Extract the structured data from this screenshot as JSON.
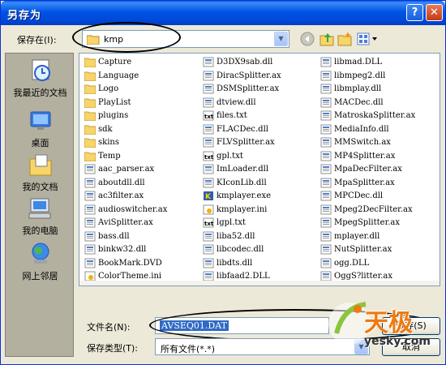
{
  "window": {
    "title": "另存为"
  },
  "titlebar": {
    "help": "?",
    "close": "✕"
  },
  "save_in": {
    "label": "保存在(I):",
    "value": "kmp"
  },
  "places": [
    {
      "label": "我最近的文档",
      "icon": "recent-docs-icon"
    },
    {
      "label": "桌面",
      "icon": "desktop-icon"
    },
    {
      "label": "我的文档",
      "icon": "my-documents-icon"
    },
    {
      "label": "我的电脑",
      "icon": "my-computer-icon"
    },
    {
      "label": "网上邻居",
      "icon": "network-icon"
    }
  ],
  "files": {
    "col1": [
      {
        "name": "Capture",
        "type": "folder"
      },
      {
        "name": "Language",
        "type": "folder"
      },
      {
        "name": "Logo",
        "type": "folder"
      },
      {
        "name": "PlayList",
        "type": "folder"
      },
      {
        "name": "plugins",
        "type": "folder"
      },
      {
        "name": "sdk",
        "type": "folder"
      },
      {
        "name": "skins",
        "type": "folder"
      },
      {
        "name": "Temp",
        "type": "folder"
      },
      {
        "name": "aac_parser.ax",
        "type": "ax"
      },
      {
        "name": "aboutdll.dll",
        "type": "dll"
      },
      {
        "name": "ac3filter.ax",
        "type": "ax"
      },
      {
        "name": "audioswitcher.ax",
        "type": "ax"
      },
      {
        "name": "AviSplitter.ax",
        "type": "ax"
      },
      {
        "name": "bass.dll",
        "type": "dll"
      },
      {
        "name": "binkw32.dll",
        "type": "dll"
      },
      {
        "name": "BookMark.DVD",
        "type": "dvd"
      },
      {
        "name": "ColorTheme.ini",
        "type": "ini"
      }
    ],
    "col2": [
      {
        "name": "D3DX9sab.dll",
        "type": "dll"
      },
      {
        "name": "DiracSplitter.ax",
        "type": "ax"
      },
      {
        "name": "DSMSplitter.ax",
        "type": "ax"
      },
      {
        "name": "dtview.dll",
        "type": "dll"
      },
      {
        "name": "files.txt",
        "type": "txt"
      },
      {
        "name": "FLACDec.dll",
        "type": "dll"
      },
      {
        "name": "FLVSplitter.ax",
        "type": "ax"
      },
      {
        "name": "gpl.txt",
        "type": "txt"
      },
      {
        "name": "ImLoader.dll",
        "type": "dll"
      },
      {
        "name": "KIconLib.dll",
        "type": "dll"
      },
      {
        "name": "kmplayer.exe",
        "type": "exe"
      },
      {
        "name": "kmplayer.ini",
        "type": "ini"
      },
      {
        "name": "lgpl.txt",
        "type": "txt"
      },
      {
        "name": "liba52.dll",
        "type": "dll"
      },
      {
        "name": "libcodec.dll",
        "type": "dll"
      },
      {
        "name": "libdts.dll",
        "type": "dll"
      },
      {
        "name": "libfaad2.DLL",
        "type": "dll"
      }
    ],
    "col3": [
      {
        "name": "libmad.DLL",
        "type": "dll"
      },
      {
        "name": "libmpeg2.dll",
        "type": "dll"
      },
      {
        "name": "libmplay.dll",
        "type": "dll"
      },
      {
        "name": "MACDec.dll",
        "type": "dll"
      },
      {
        "name": "MatroskaSplitter.ax",
        "type": "ax"
      },
      {
        "name": "MediaInfo.dll",
        "type": "dll"
      },
      {
        "name": "MMSwitch.ax",
        "type": "ax"
      },
      {
        "name": "MP4Splitter.ax",
        "type": "ax"
      },
      {
        "name": "MpaDecFilter.ax",
        "type": "ax"
      },
      {
        "name": "MpaSplitter.ax",
        "type": "ax"
      },
      {
        "name": "MPCDec.dll",
        "type": "dll"
      },
      {
        "name": "Mpeg2DecFilter.ax",
        "type": "ax"
      },
      {
        "name": "MpegSplitter.ax",
        "type": "ax"
      },
      {
        "name": "mplayer.dll",
        "type": "dll"
      },
      {
        "name": "NutSplitter.ax",
        "type": "ax"
      },
      {
        "name": "ogg.DLL",
        "type": "dll"
      },
      {
        "name": "OggS?litter.ax",
        "type": "ax"
      }
    ]
  },
  "filename": {
    "label": "文件名(N):",
    "value": "AVSEQ01.DAT"
  },
  "filetype": {
    "label": "保存类型(T):",
    "value": "所有文件(*.*)"
  },
  "buttons": {
    "save": "保存(S)",
    "cancel": "取消"
  },
  "watermark": {
    "text": "天极",
    "url": "yesky.com"
  }
}
